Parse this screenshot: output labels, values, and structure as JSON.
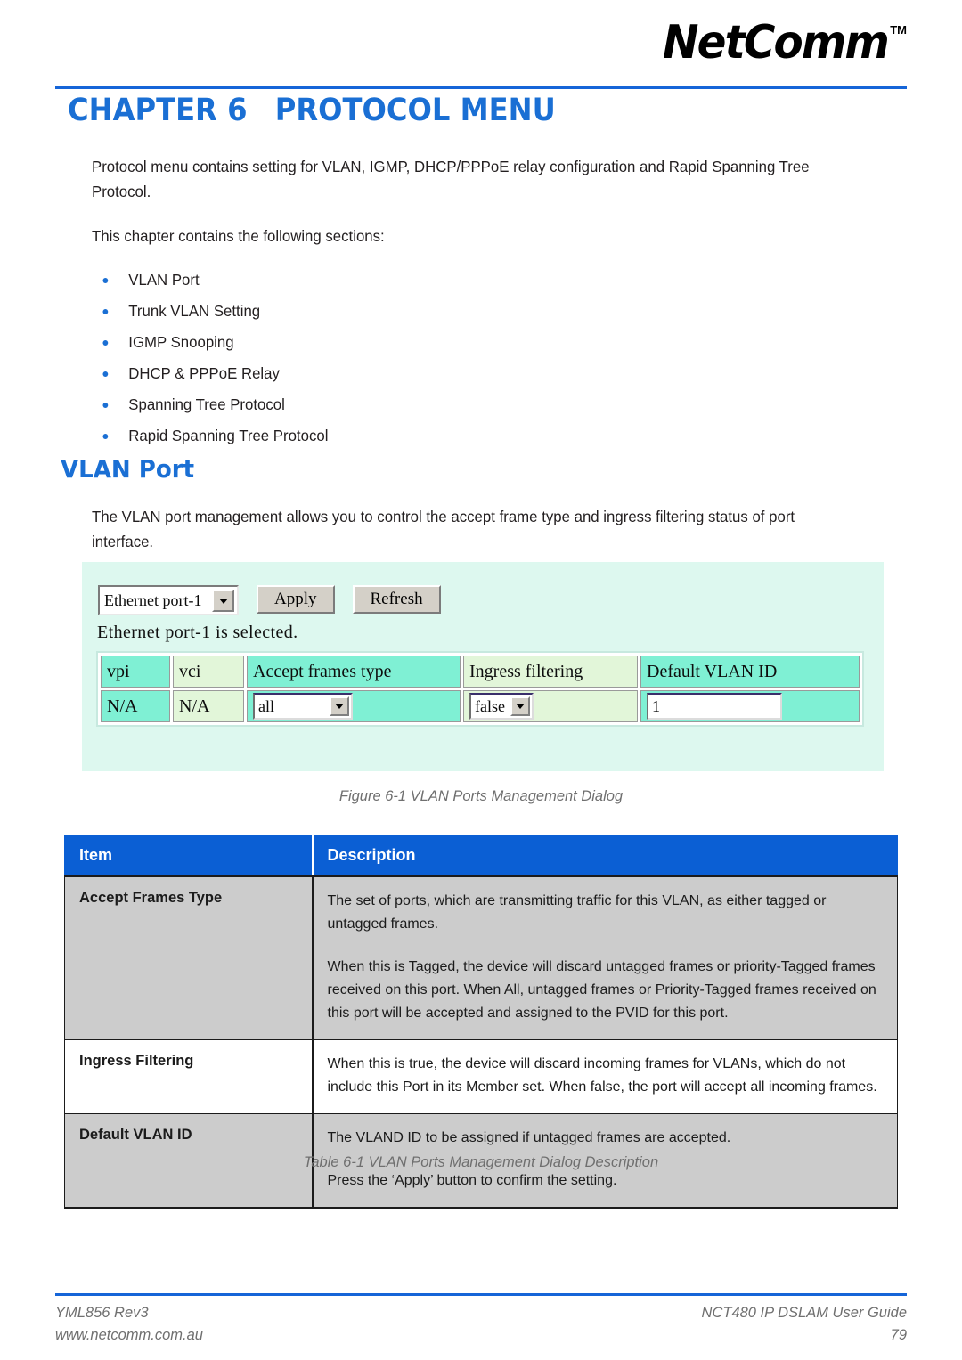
{
  "header": {
    "logo_text": "NetComm",
    "logo_tm": "TM",
    "accent_color": "#1a6fd4"
  },
  "chapter": {
    "number_label": "CHAPTER 6",
    "title": "PROTOCOL MENU"
  },
  "intro": {
    "paragraph_1": "Protocol menu contains setting for VLAN, IGMP, DHCP/PPPoE relay configuration and Rapid Spanning Tree Protocol.",
    "paragraph_2": "This chapter contains the following sections:",
    "sections": [
      "VLAN Port",
      "Trunk VLAN Setting",
      "IGMP Snooping",
      "DHCP & PPPoE Relay",
      "Spanning Tree Protocol",
      "Rapid Spanning Tree Protocol"
    ]
  },
  "vlan_port": {
    "heading": "VLAN Port",
    "paragraph": "The VLAN port management allows you to control the accept frame type and ingress filtering status of port interface."
  },
  "app_screenshot": {
    "port_select_value": "Ethernet port-1",
    "apply_label": "Apply",
    "refresh_label": "Refresh",
    "status_text": "Ethernet port-1 is selected.",
    "table": {
      "headers": [
        "vpi",
        "vci",
        "Accept frames type",
        "Ingress filtering",
        "Default VLAN ID"
      ],
      "row": {
        "vpi": "N/A",
        "vci": "N/A",
        "accept_frames_type": "all",
        "ingress_filtering": "false",
        "default_vlan_id": "1"
      }
    },
    "background_color": "#ddf8ef",
    "cell_aqua": "#7ff0d4",
    "cell_lime": "#e2f6d9"
  },
  "figure_caption": "Figure 6-1 VLAN Ports Management Dialog",
  "table_caption": "Table 6-1 VLAN Ports Management Dialog Description",
  "description_table": {
    "headers": {
      "item": "Item",
      "description": "Description"
    },
    "rows": [
      {
        "item": "Accept Frames Type",
        "paragraphs": [
          "The set of ports, which are transmitting traffic for this VLAN, as either tagged or untagged frames.",
          "When this is Tagged, the device will discard untagged frames or priority-Tagged frames received on this port. When All, untagged frames or Priority-Tagged frames received on this port will be accepted and assigned to the PVID for this port."
        ]
      },
      {
        "item": "Ingress Filtering",
        "paragraphs": [
          "When this is true, the device will discard incoming frames for VLANs, which do not include this Port in its Member set. When false, the port will accept all incoming frames."
        ]
      },
      {
        "item": "Default VLAN ID",
        "paragraphs": [
          "The VLAND ID to be assigned if untagged frames are accepted.",
          "Press the ‘Apply’ button to confirm the setting."
        ]
      }
    ]
  },
  "footer": {
    "doc_ref": "YML856 Rev3",
    "website": "www.netcomm.com.au",
    "guide_title": "NCT480 IP DSLAM User Guide",
    "page_number": "79"
  }
}
